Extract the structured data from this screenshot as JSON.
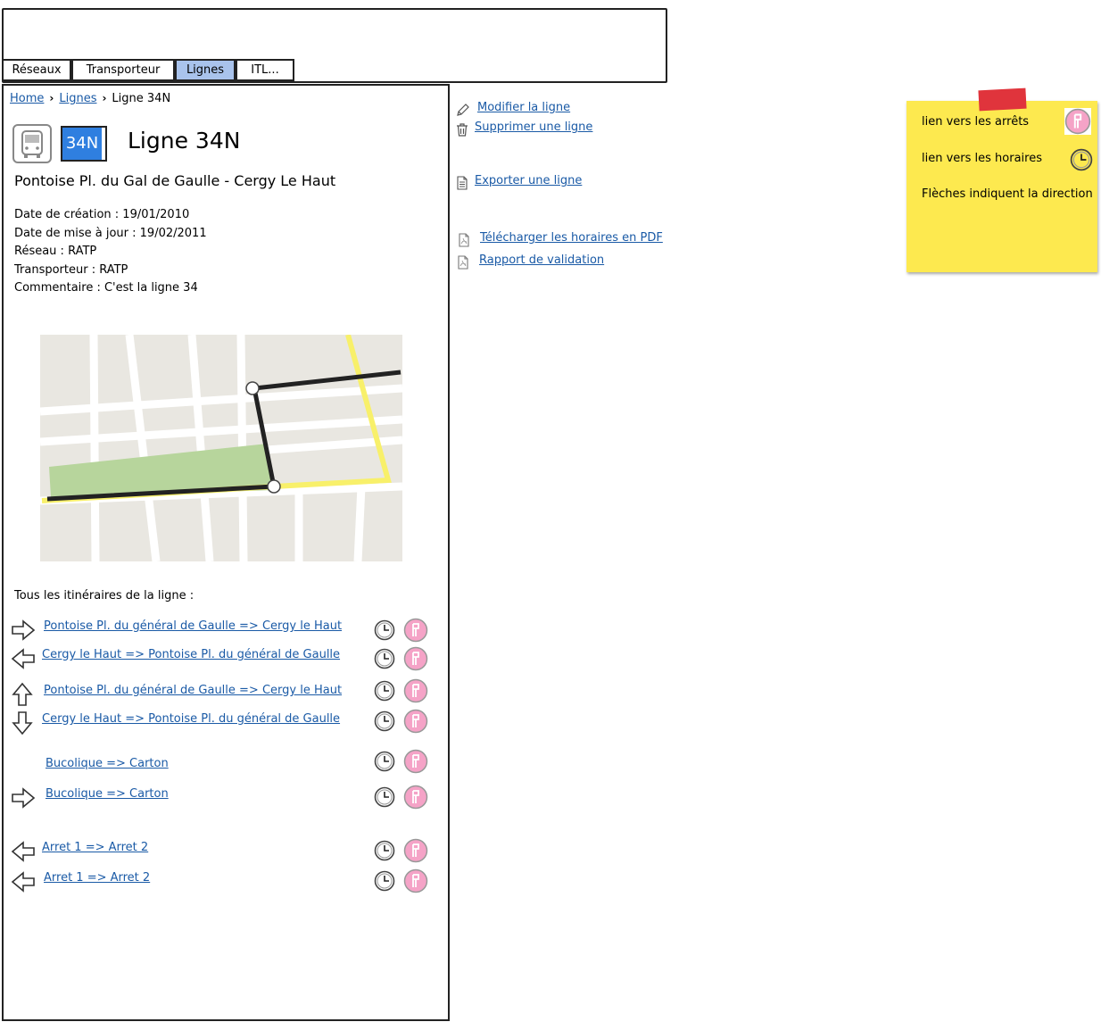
{
  "tabs": [
    {
      "label": "Réseaux",
      "active": false
    },
    {
      "label": "Transporteur",
      "active": false
    },
    {
      "label": "Lignes",
      "active": true
    },
    {
      "label": "ITL...",
      "active": false
    }
  ],
  "breadcrumb": {
    "home": "Home",
    "lines": "Lignes",
    "current": "Ligne 34N"
  },
  "line": {
    "badge": "34N",
    "title": "Ligne 34N",
    "subtitle": "Pontoise Pl. du Gal de Gaulle - Cergy Le Haut",
    "creation": "Date de création : 19/01/2010",
    "update": "Date de mise à jour : 19/02/2011",
    "network": "Réseau : RATP",
    "carrier": "Transporteur : RATP",
    "comment": "Commentaire :  C'est la ligne 34"
  },
  "routes": {
    "heading": "Tous les itinéraires de la ligne :",
    "items": [
      {
        "label": "Pontoise Pl. du général de Gaulle => Cergy le Haut",
        "arrow": "right"
      },
      {
        "label": "Cergy le Haut => Pontoise Pl. du général de Gaulle",
        "arrow": "left"
      },
      {
        "label": "Pontoise Pl. du général de Gaulle => Cergy le Haut",
        "arrow": "up"
      },
      {
        "label": "Cergy le Haut => Pontoise Pl. du général de Gaulle",
        "arrow": "down"
      },
      {
        "label": "Bucolique => Carton",
        "arrow": "none"
      },
      {
        "label": "Bucolique => Carton",
        "arrow": "right"
      },
      {
        "label": "Arret 1 => Arret 2",
        "arrow": "left"
      },
      {
        "label": "Arret 1 => Arret 2",
        "arrow": "left"
      }
    ]
  },
  "actions": {
    "modify": "Modifier la ligne",
    "delete": "Supprimer une ligne",
    "export": "Exporter une ligne",
    "download_pdf": "Télécharger les horaires en PDF",
    "validation": "Rapport de validation"
  },
  "note": {
    "stops": "lien vers les arrêts",
    "timetables": "lien vers les horaires",
    "arrows": "Flèches indiquent la direction"
  },
  "colors": {
    "active_tab": "#a9c3ec",
    "badge": "#2f7fe0",
    "link": "#1a5aa6",
    "note": "#fde94f",
    "stop_icon": "#f5a3c7"
  },
  "icons": [
    "bus-icon",
    "pencil-icon",
    "trash-icon",
    "document-icon",
    "pdf-icon",
    "clock-icon",
    "stop-icon",
    "arrow-icon"
  ]
}
